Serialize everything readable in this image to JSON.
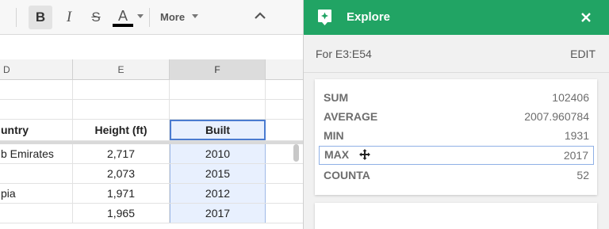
{
  "toolbar": {
    "bold_label": "B",
    "italic_label": "I",
    "strike_label": "S",
    "text_color_label": "A",
    "text_color_bar_color": "#000000",
    "more_label": "More",
    "icons": [
      "bold-icon",
      "italic-icon",
      "strikethrough-icon",
      "text-color-icon",
      "chevron-down-icon",
      "collapse-chevron-icon"
    ]
  },
  "sheet": {
    "columns": [
      "D",
      "E",
      "F"
    ],
    "selected_column": "F",
    "header_row": [
      "untry",
      "Height (ft)",
      "Built"
    ],
    "rows": [
      [
        "b Emirates",
        "2,717",
        "2010"
      ],
      [
        "",
        "2,073",
        "2015"
      ],
      [
        "pia",
        "1,971",
        "2012"
      ],
      [
        "",
        "1,965",
        "2017"
      ]
    ]
  },
  "panel": {
    "title": "Explore",
    "header_color": "#21a464",
    "range_label": "For E3:E54",
    "edit_label": "EDIT",
    "stats": [
      {
        "label": "SUM",
        "value": "102406"
      },
      {
        "label": "AVERAGE",
        "value": "2007.960784"
      },
      {
        "label": "MIN",
        "value": "1931"
      },
      {
        "label": "MAX",
        "value": "2017"
      },
      {
        "label": "COUNTA",
        "value": "52"
      }
    ]
  }
}
